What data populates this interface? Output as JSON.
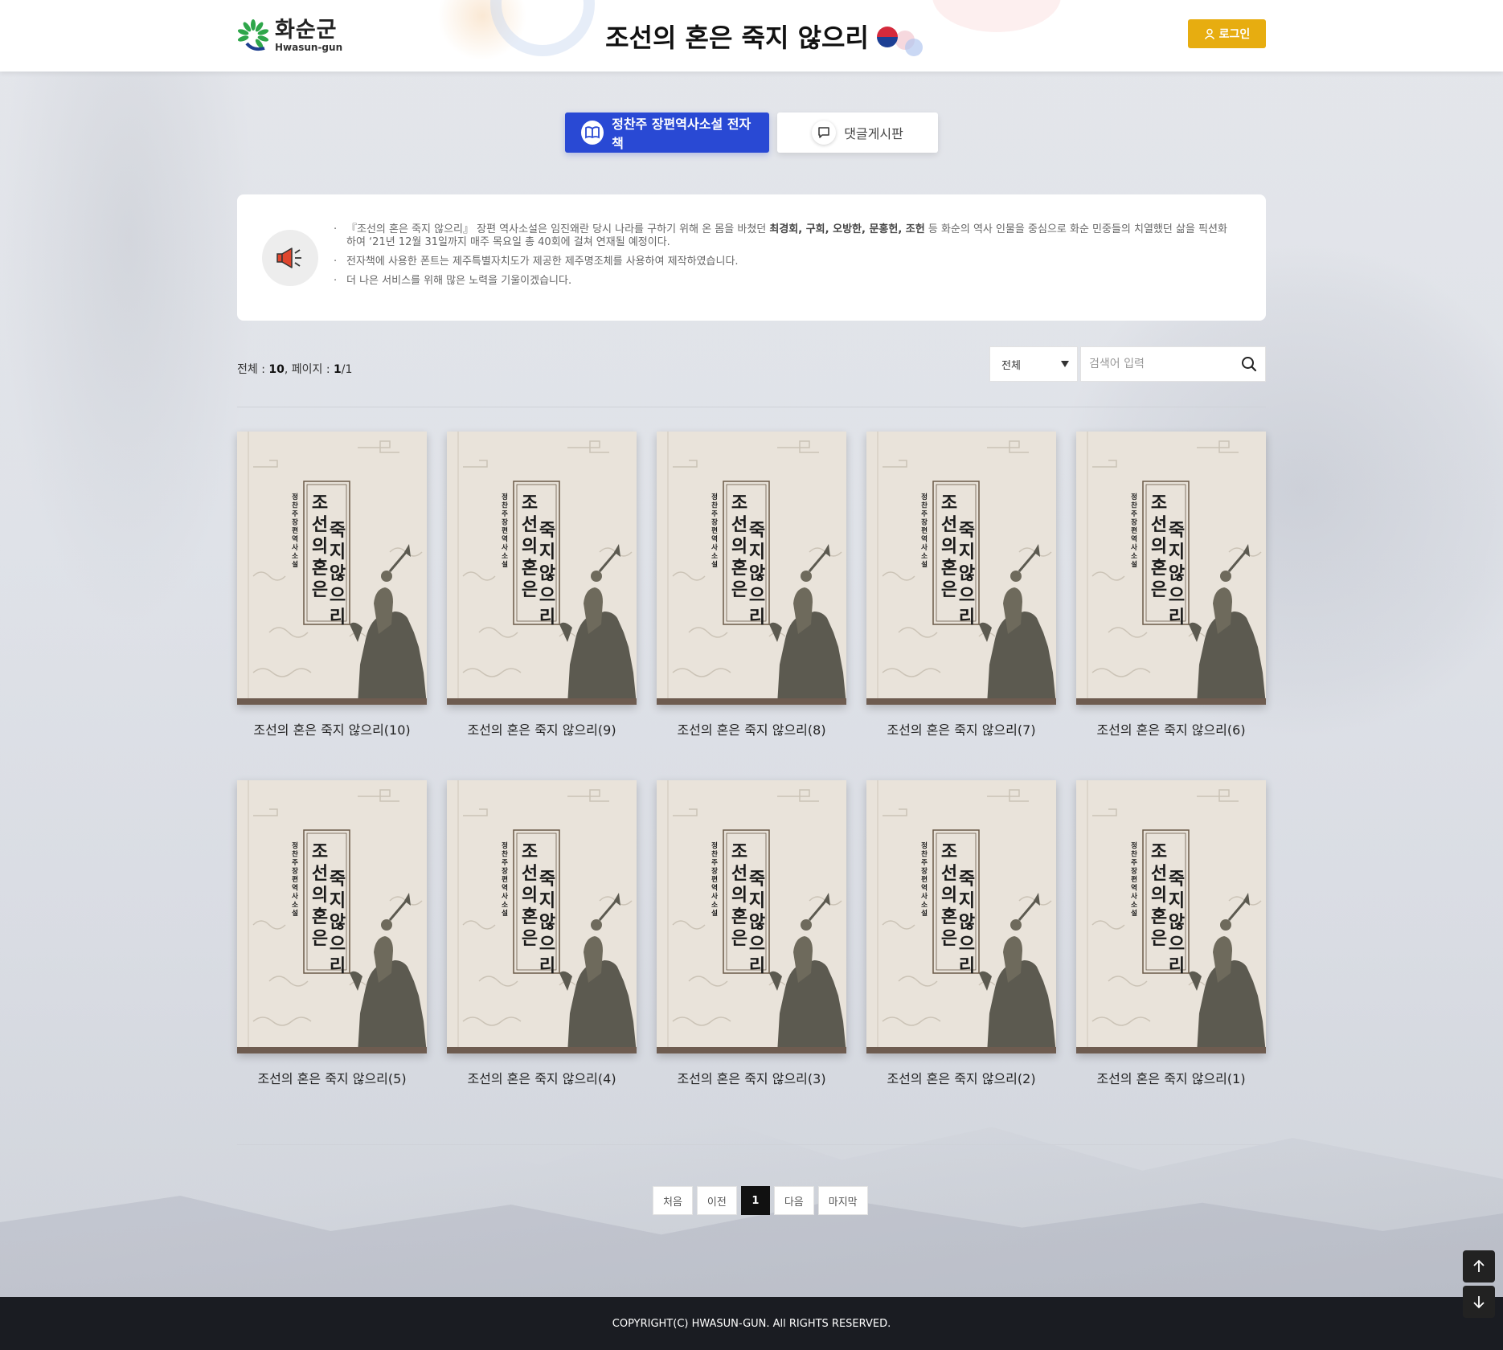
{
  "header": {
    "logo_ko": "화순군",
    "logo_en": "Hwasun-gun",
    "site_title": "조선의 혼은 죽지 않으리",
    "login_label": "로그인"
  },
  "tabs": [
    {
      "label": "정찬주 장편역사소설 전자책",
      "icon": "book-icon",
      "active": true
    },
    {
      "label": "댓글게시판",
      "icon": "speech-bubble-icon",
      "active": false
    }
  ],
  "notice": {
    "icon": "megaphone-icon",
    "line1_pre": "『조선의 혼은 죽지 않으리』 장편 역사소설은 임진왜란 당시 나라를 구하기 위해 온 몸을 바쳤던 ",
    "line1_bold": "최경회, 구희, 오방한, 문홍헌, 조헌",
    "line1_post": " 등 화순의 역사 인물을 중심으로 화순 민중들의 치열했던 삶을 픽션화하여 ‘21년 12월 31일까지 매주 목요일 총 40회에 걸쳐 연재될 예정이다.",
    "line2": "전자책에 사용한 폰트는 제주특별자치도가 제공한 제주명조체를 사용하여 제작하였습니다.",
    "line3": "더 나은 서비스를 위해 많은 노력을 기울이겠습니다."
  },
  "list_info": {
    "total_label": "전체 : ",
    "total": "10",
    "page_label": ", 페이지 : ",
    "page_current": "1",
    "page_total": "/1"
  },
  "search": {
    "select_value": "전체",
    "placeholder": "검색어 입력"
  },
  "books": [
    {
      "title": "조선의 혼은 죽지 않으리(10)"
    },
    {
      "title": "조선의 혼은 죽지 않으리(9)"
    },
    {
      "title": "조선의 혼은 죽지 않으리(8)"
    },
    {
      "title": "조선의 혼은 죽지 않으리(7)"
    },
    {
      "title": "조선의 혼은 죽지 않으리(6)"
    },
    {
      "title": "조선의 혼은 죽지 않으리(5)"
    },
    {
      "title": "조선의 혼은 죽지 않으리(4)"
    },
    {
      "title": "조선의 혼은 죽지 않으리(3)"
    },
    {
      "title": "조선의 혼은 죽지 않으리(2)"
    },
    {
      "title": "조선의 혼은 죽지 않으리(1)"
    }
  ],
  "cover": {
    "subtitle": "정찬주 장편역사소설",
    "title_col1": "조선의 혼은",
    "title_col2": "죽지 않으리"
  },
  "pagination": {
    "first": "처음",
    "prev": "이전",
    "current": "1",
    "next": "다음",
    "last": "마지막"
  },
  "footer": {
    "copyright": "COPYRIGHT(C) HWASUN-GUN. All RIGHTS RESERVED."
  },
  "colors": {
    "accent_blue": "#2949d4",
    "login_yellow": "#e7ad10",
    "footer_bg": "#1a1c22"
  }
}
